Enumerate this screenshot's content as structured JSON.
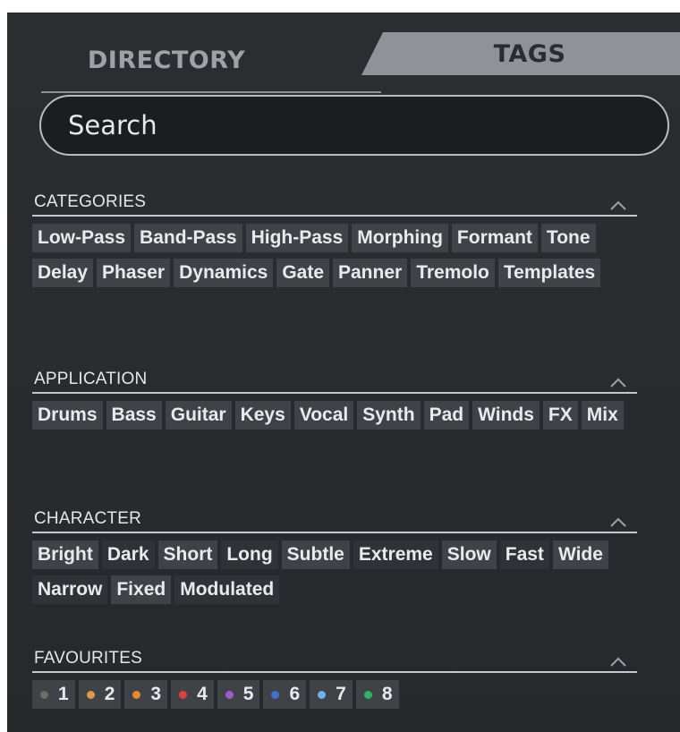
{
  "tabs": {
    "directory": "DIRECTORY",
    "tags": "TAGS"
  },
  "search": {
    "placeholder": "Search"
  },
  "categories": {
    "title": "CATEGORIES",
    "items": [
      "Low-Pass",
      "Band-Pass",
      "High-Pass",
      "Morphing",
      "Formant",
      "Tone",
      "Delay",
      "Phaser",
      "Dynamics",
      "Gate",
      "Panner",
      "Tremolo",
      "Templates"
    ]
  },
  "application": {
    "title": "APPLICATION",
    "items": [
      "Drums",
      "Bass",
      "Guitar",
      "Keys",
      "Vocal",
      "Synth",
      "Pad",
      "Winds",
      "FX",
      "Mix"
    ]
  },
  "character": {
    "title": "CHARACTER",
    "items": [
      "Bright",
      "Dark",
      "Short",
      "Long",
      "Subtle",
      "Extreme",
      "Slow",
      "Fast",
      "Wide",
      "Narrow",
      "Fixed",
      "Modulated"
    ]
  },
  "favourites": {
    "title": "FAVOURITES",
    "items": [
      {
        "label": "1",
        "color": "#6f6d62"
      },
      {
        "label": "2",
        "color": "#d99a4a"
      },
      {
        "label": "3",
        "color": "#e68a2b"
      },
      {
        "label": "4",
        "color": "#d9453a"
      },
      {
        "label": "5",
        "color": "#9a5fc7"
      },
      {
        "label": "6",
        "color": "#3f72c9"
      },
      {
        "label": "7",
        "color": "#6fb2e6"
      },
      {
        "label": "8",
        "color": "#2fb36b"
      }
    ]
  },
  "colors": {
    "panel": "#282b2e",
    "tag_bg": "#3f4347",
    "tag_alt_bg": "#2f3236",
    "active_tab": "#8f9397"
  },
  "icons": {
    "collapse": "chevron-up-icon"
  }
}
